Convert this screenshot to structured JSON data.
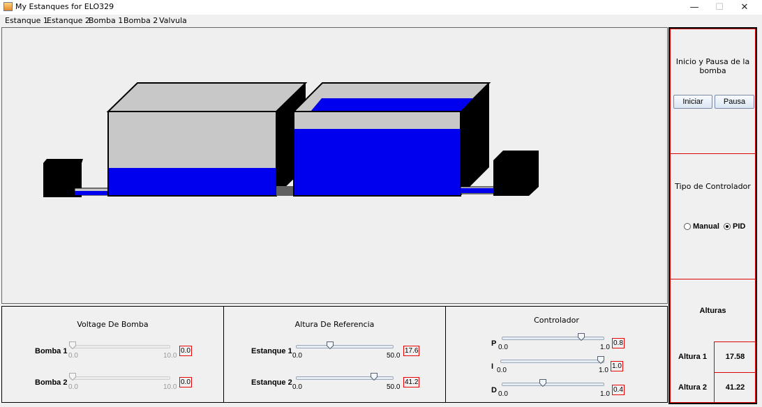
{
  "window": {
    "title": "My Estanques for ELO329",
    "minimize": "—",
    "maximize": "☐",
    "close": "✕"
  },
  "menu": [
    "Estanque 1",
    "Estanque 2",
    "Bomba 1",
    "Bomba 2",
    "Valvula"
  ],
  "simulation": {
    "tank1_level": 0.33,
    "tank2_level": 0.8,
    "colors": {
      "water": "#0000ee",
      "tank": "#c8c8c8",
      "dark": "#000000",
      "valve": "#606060"
    }
  },
  "voltage": {
    "title": "Voltage De Bomba",
    "bomba1": {
      "label": "Bomba 1",
      "min": "0.0",
      "max": "10.0",
      "value": "0.0",
      "fraction": 0.0
    },
    "bomba2": {
      "label": "Bomba 2",
      "min": "0.0",
      "max": "10.0",
      "value": "0.0",
      "fraction": 0.0
    }
  },
  "reference": {
    "title": "Altura De Referencia",
    "estanque1": {
      "label": "Estanque 1",
      "min": "0.0",
      "max": "50.0",
      "value": "17.6",
      "fraction": 0.352
    },
    "estanque2": {
      "label": "Estanque 2",
      "min": "0.0",
      "max": "50.0",
      "value": "41.2",
      "fraction": 0.824
    }
  },
  "controller": {
    "title": "Controlador",
    "p": {
      "label": "P",
      "min": "0.0",
      "max": "1.0",
      "value": "0.8",
      "fraction": 0.8
    },
    "i": {
      "label": "I",
      "min": "0.0",
      "max": "1.0",
      "value": "1.0",
      "fraction": 1.0
    },
    "d": {
      "label": "D",
      "min": "0.0",
      "max": "1.0",
      "value": "0.4",
      "fraction": 0.4
    }
  },
  "pump_control": {
    "title": "Inicio y Pausa de la bomba",
    "start": "Iniciar",
    "pause": "Pausa"
  },
  "controller_type": {
    "title": "Tipo de Controlador",
    "manual": "Manual",
    "pid": "PID",
    "selected": "PID"
  },
  "heights": {
    "title": "Alturas",
    "rows": [
      {
        "label": "Altura 1",
        "value": "17.58"
      },
      {
        "label": "Altura 2",
        "value": "41.22"
      }
    ]
  }
}
